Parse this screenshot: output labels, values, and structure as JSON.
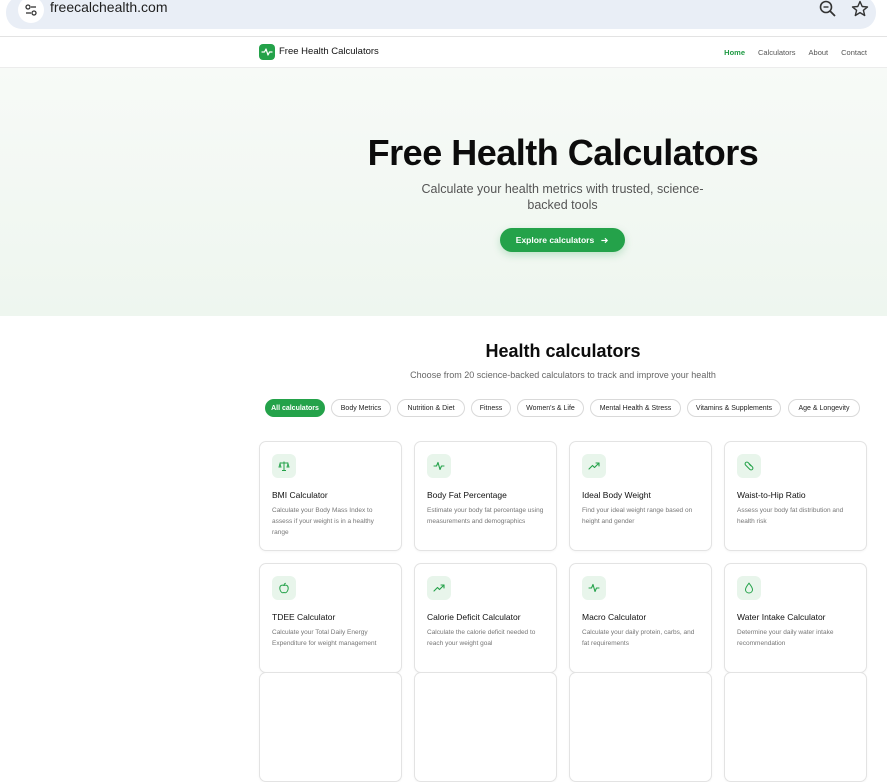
{
  "browser": {
    "url": "freecalchealth.com",
    "icons": [
      "site-info-icon",
      "zoom-icon",
      "star-icon"
    ]
  },
  "nav": {
    "brand": "Free Health Calculators",
    "links": [
      "Home",
      "Calculators",
      "About",
      "Contact"
    ],
    "active_link": "Home"
  },
  "hero": {
    "title": "Free Health Calculators",
    "subtitle": "Calculate your health metrics with trusted, science-backed tools",
    "cta_label": "Explore calculators"
  },
  "calculators_section": {
    "title": "Health calculators",
    "subtitle": "Choose from 20 science-backed calculators to track and improve your health",
    "filters": [
      "All calculators",
      "Body Metrics",
      "Nutrition & Diet",
      "Fitness",
      "Women's & Life",
      "Mental Health & Stress",
      "Vitamins & Supplements",
      "Age & Longevity"
    ],
    "active_filter": "All calculators",
    "cards": [
      {
        "title": "BMI Calculator",
        "description": "Calculate your Body Mass Index to assess if your weight is in a healthy range",
        "icon": "scale-icon"
      },
      {
        "title": "Body Fat Percentage",
        "description": "Estimate your body fat percentage using measurements and demographics",
        "icon": "activity-icon"
      },
      {
        "title": "Ideal Body Weight",
        "description": "Find your ideal weight range based on height and gender",
        "icon": "trending-up-icon"
      },
      {
        "title": "Waist-to-Hip Ratio",
        "description": "Assess your body fat distribution and health risk",
        "icon": "tape-icon"
      },
      {
        "title": "TDEE Calculator",
        "description": "Calculate your Total Daily Energy Expenditure for weight management",
        "icon": "apple-icon"
      },
      {
        "title": "Calorie Deficit Calculator",
        "description": "Calculate the calorie deficit needed to reach your weight goal",
        "icon": "trending-up-icon"
      },
      {
        "title": "Macro Calculator",
        "description": "Calculate your daily protein, carbs, and fat requirements",
        "icon": "activity-icon"
      },
      {
        "title": "Water Intake Calculator",
        "description": "Determine your daily water intake recommendation",
        "icon": "droplet-icon"
      }
    ]
  },
  "colors": {
    "accent": "#24a24a",
    "icon_bg": "#e8f5eb"
  }
}
